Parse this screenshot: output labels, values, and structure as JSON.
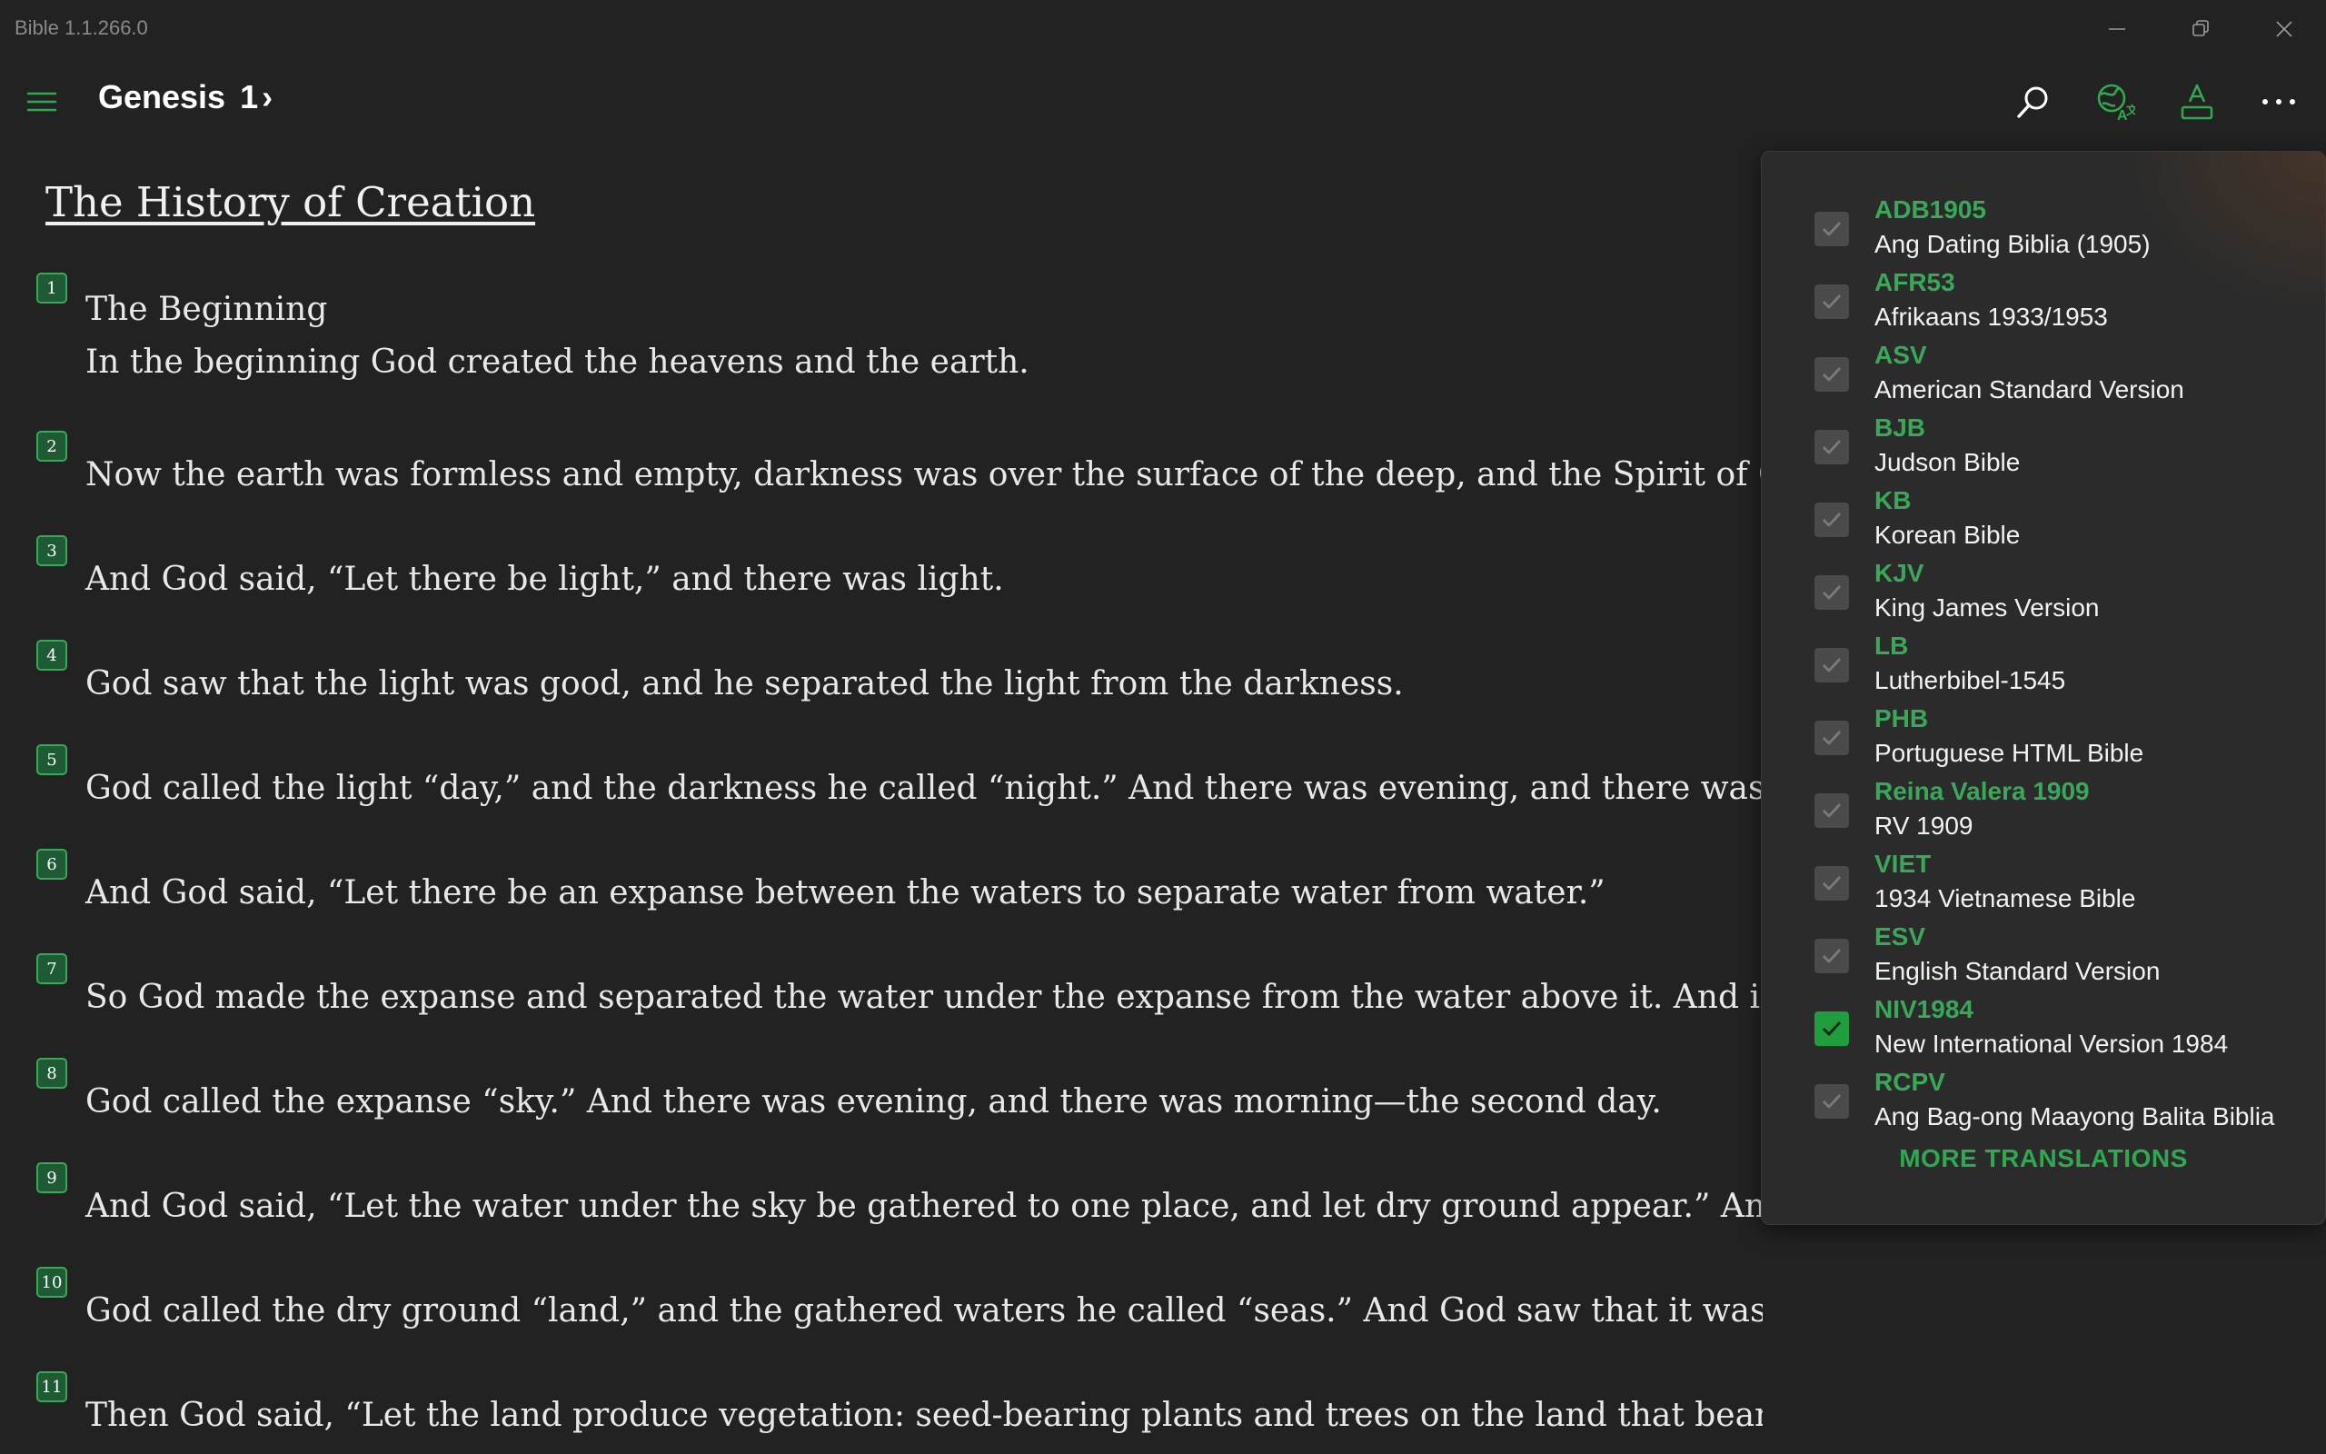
{
  "window": {
    "title": "Bible 1.1.266.0",
    "minimize_icon": "minimize-icon",
    "maximize_icon": "restore-icon",
    "close_icon": "close-icon"
  },
  "header": {
    "book": "Genesis",
    "chapter": "1",
    "chapter_arrow": "›",
    "menu_icon": "hamburger-icon",
    "accent_color": "#2fa84f",
    "icons": [
      "search-icon",
      "translate-icon",
      "font-size-icon",
      "more-icon"
    ]
  },
  "content": {
    "section_title": "The History of Creation",
    "verses": [
      {
        "num": "1",
        "heading": "The Beginning",
        "text": "In the beginning God created the heavens and the earth."
      },
      {
        "num": "2",
        "text": "Now the earth was formless and empty, darkness was over the surface of the deep, and the Spirit of God was hove"
      },
      {
        "num": "3",
        "text": "And God said, “Let there be light,” and there was light."
      },
      {
        "num": "4",
        "text": "God saw that the light was good, and he separated the light from the darkness."
      },
      {
        "num": "5",
        "text": "God called the light “day,” and the darkness he called “night.” And there was evening, and there was morning—th"
      },
      {
        "num": "6",
        "text": "And God said, “Let there be an expanse between the waters to separate water from water.”"
      },
      {
        "num": "7",
        "text": "So God made the expanse and separated the water under the expanse from the water above it. And it was so."
      },
      {
        "num": "8",
        "text": "God called the expanse “sky.” And there was evening, and there was morning—the second day."
      },
      {
        "num": "9",
        "text": "And God said, “Let the water under the sky be gathered to one place, and let dry ground appear.” And it was so."
      },
      {
        "num": "10",
        "text": "God called the dry ground “land,” and the gathered waters he called “seas.” And God saw that it was good."
      },
      {
        "num": "11",
        "text": "Then God said, “Let the land produce vegetation: seed-bearing plants and trees on the land that bear fruit with seed in it, according to their"
      }
    ]
  },
  "translations_popup": {
    "items": [
      {
        "code": "ADB1905",
        "name": "Ang Dating Biblia (1905)",
        "checked": false
      },
      {
        "code": "AFR53",
        "name": "Afrikaans 1933/1953",
        "checked": false
      },
      {
        "code": "ASV",
        "name": "American Standard Version",
        "checked": false
      },
      {
        "code": "BJB",
        "name": "Judson Bible",
        "checked": false
      },
      {
        "code": "KB",
        "name": "Korean Bible",
        "checked": false
      },
      {
        "code": "KJV",
        "name": "King James Version",
        "checked": false
      },
      {
        "code": "LB",
        "name": "Lutherbibel-1545",
        "checked": false
      },
      {
        "code": "PHB",
        "name": "Portuguese HTML Bible",
        "checked": false
      },
      {
        "code": "Reina Valera 1909",
        "name": "RV 1909",
        "checked": false
      },
      {
        "code": "VIET",
        "name": "1934 Vietnamese Bible",
        "checked": false
      },
      {
        "code": "ESV",
        "name": "English Standard Version",
        "checked": false
      },
      {
        "code": "NIV1984",
        "name": "New International Version 1984",
        "checked": true
      },
      {
        "code": "RCPV",
        "name": "Ang Bag-ong Maayong Balita Biblia",
        "checked": false
      }
    ],
    "more_label": "MORE TRANSLATIONS"
  }
}
